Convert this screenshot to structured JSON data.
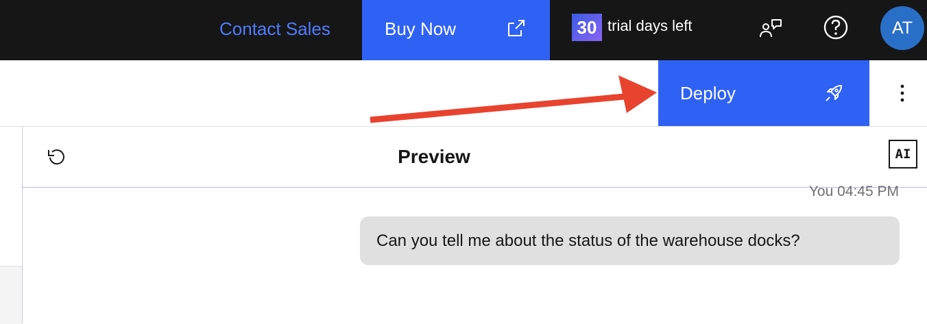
{
  "topbar": {
    "contact_sales_label": "Contact Sales",
    "buy_now_label": "Buy Now",
    "trial_days": "30",
    "trial_text": "trial days left",
    "avatar_initials": "AT"
  },
  "toolbar": {
    "deploy_label": "Deploy"
  },
  "preview": {
    "title": "Preview",
    "ai_badge": "AI",
    "message": {
      "sender_time": "You 04:45 PM",
      "text": "Can you tell me about the status of the warehouse docks?"
    }
  },
  "colors": {
    "topbar_bg": "#161616",
    "primary": "#2f62f4",
    "link": "#4f7cff",
    "annotation_arrow": "#e8432e",
    "avatar": "#2a6fc7"
  },
  "icons": {
    "buy_now": "launch-icon",
    "deploy": "rocket-icon",
    "community": "user-chat-icon",
    "help": "help-icon",
    "overflow": "overflow-menu-icon",
    "reset": "reset-icon"
  }
}
